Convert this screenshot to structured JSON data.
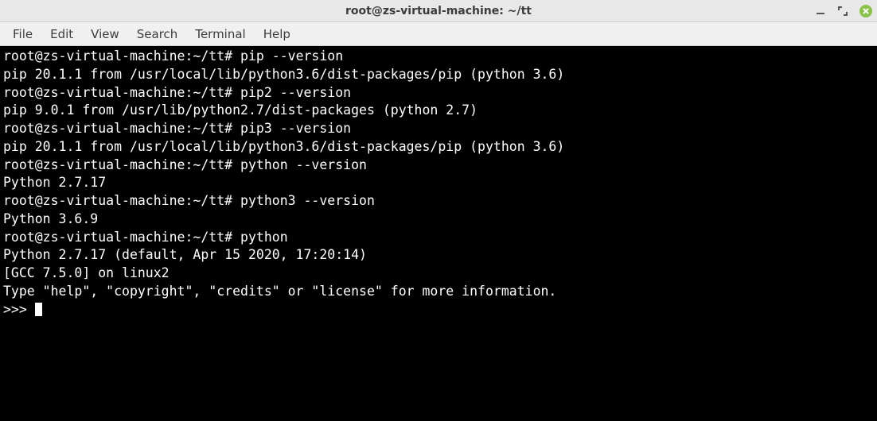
{
  "window": {
    "title": "root@zs-virtual-machine: ~/tt"
  },
  "menubar": {
    "items": [
      "File",
      "Edit",
      "View",
      "Search",
      "Terminal",
      "Help"
    ]
  },
  "terminal": {
    "lines": [
      {
        "prompt": "root@zs-virtual-machine:~/tt#",
        "cmd": " pip --version"
      },
      {
        "out": "pip 20.1.1 from /usr/local/lib/python3.6/dist-packages/pip (python 3.6)"
      },
      {
        "prompt": "root@zs-virtual-machine:~/tt#",
        "cmd": " pip2 --version"
      },
      {
        "out": "pip 9.0.1 from /usr/lib/python2.7/dist-packages (python 2.7)"
      },
      {
        "prompt": "root@zs-virtual-machine:~/tt#",
        "cmd": " pip3 --version"
      },
      {
        "out": "pip 20.1.1 from /usr/local/lib/python3.6/dist-packages/pip (python 3.6)"
      },
      {
        "prompt": "root@zs-virtual-machine:~/tt#",
        "cmd": " python --version"
      },
      {
        "out": "Python 2.7.17"
      },
      {
        "prompt": "root@zs-virtual-machine:~/tt#",
        "cmd": " python3 --version"
      },
      {
        "out": "Python 3.6.9"
      },
      {
        "prompt": "root@zs-virtual-machine:~/tt#",
        "cmd": " python"
      },
      {
        "out": "Python 2.7.17 (default, Apr 15 2020, 17:20:14) "
      },
      {
        "out": "[GCC 7.5.0] on linux2"
      },
      {
        "out": "Type \"help\", \"copyright\", \"credits\" or \"license\" for more information."
      }
    ],
    "repl_prompt": ">>> "
  }
}
